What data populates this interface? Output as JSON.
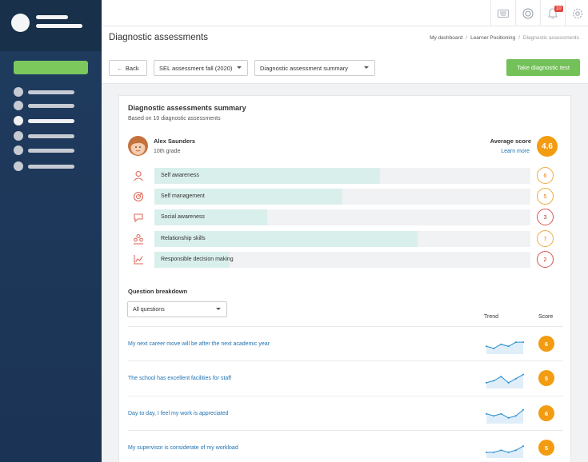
{
  "header": {
    "page_title": "Diagnostic assessments",
    "breadcrumb": [
      "My dashboard",
      "Learner Positioning",
      "Diagnostic assessments"
    ]
  },
  "topbar": {
    "notification_count": "10",
    "icons": [
      "keyboard-icon",
      "help-icon",
      "bell-icon",
      "gear-icon"
    ]
  },
  "controls": {
    "back_label": "Back",
    "assessment_select": "SEL assessment fall (2020)",
    "view_select": "Diagnostic assessment summary",
    "take_test_label": "Take diagnostic test"
  },
  "summary": {
    "title": "Diagnostic assessments summary",
    "subtitle": "Based on 10 diagnostic assessments",
    "student_name": "Alex Saunders",
    "student_grade": "10th grade",
    "average_label": "Average score",
    "learn_more": "Learn more",
    "average_score": "4.6"
  },
  "categories": [
    {
      "label": "Self awareness",
      "score": "6",
      "fill": 0.6,
      "icon": "person-icon"
    },
    {
      "label": "Self management",
      "score": "5",
      "fill": 0.5,
      "icon": "target-icon"
    },
    {
      "label": "Social awareness",
      "score": "3",
      "fill": 0.3,
      "icon": "chat-icon"
    },
    {
      "label": "Relationship skills",
      "score": "7",
      "fill": 0.7,
      "icon": "people-icon"
    },
    {
      "label": "Responsible decision making",
      "score": "2",
      "fill": 0.2,
      "icon": "chart-icon"
    }
  ],
  "breakdown": {
    "title": "Question breakdown",
    "filter": "All questions",
    "col_trend": "Trend",
    "col_score": "Score",
    "questions": [
      {
        "text": "My next career move will be after the next academic year",
        "score": "6",
        "trend": [
          3,
          2,
          4,
          3,
          5,
          5
        ]
      },
      {
        "text": "The school has excellent facilities for staff",
        "score": "5",
        "trend": [
          2,
          3,
          5,
          2,
          4,
          6
        ]
      },
      {
        "text": "Day to day, I feel my work is appreciated",
        "score": "6",
        "trend": [
          4,
          3,
          4,
          2,
          3,
          6
        ]
      },
      {
        "text": "My supervisor is considerate of my workload",
        "score": "5",
        "trend": [
          2,
          2,
          3,
          2,
          3,
          5
        ]
      }
    ]
  },
  "colors": {
    "sidebar": "#1f3b5e",
    "accent_green": "#74c15a",
    "score_orange": "#f39c12",
    "link_blue": "#1f73b4",
    "bar_fill": "#d9efeb"
  }
}
